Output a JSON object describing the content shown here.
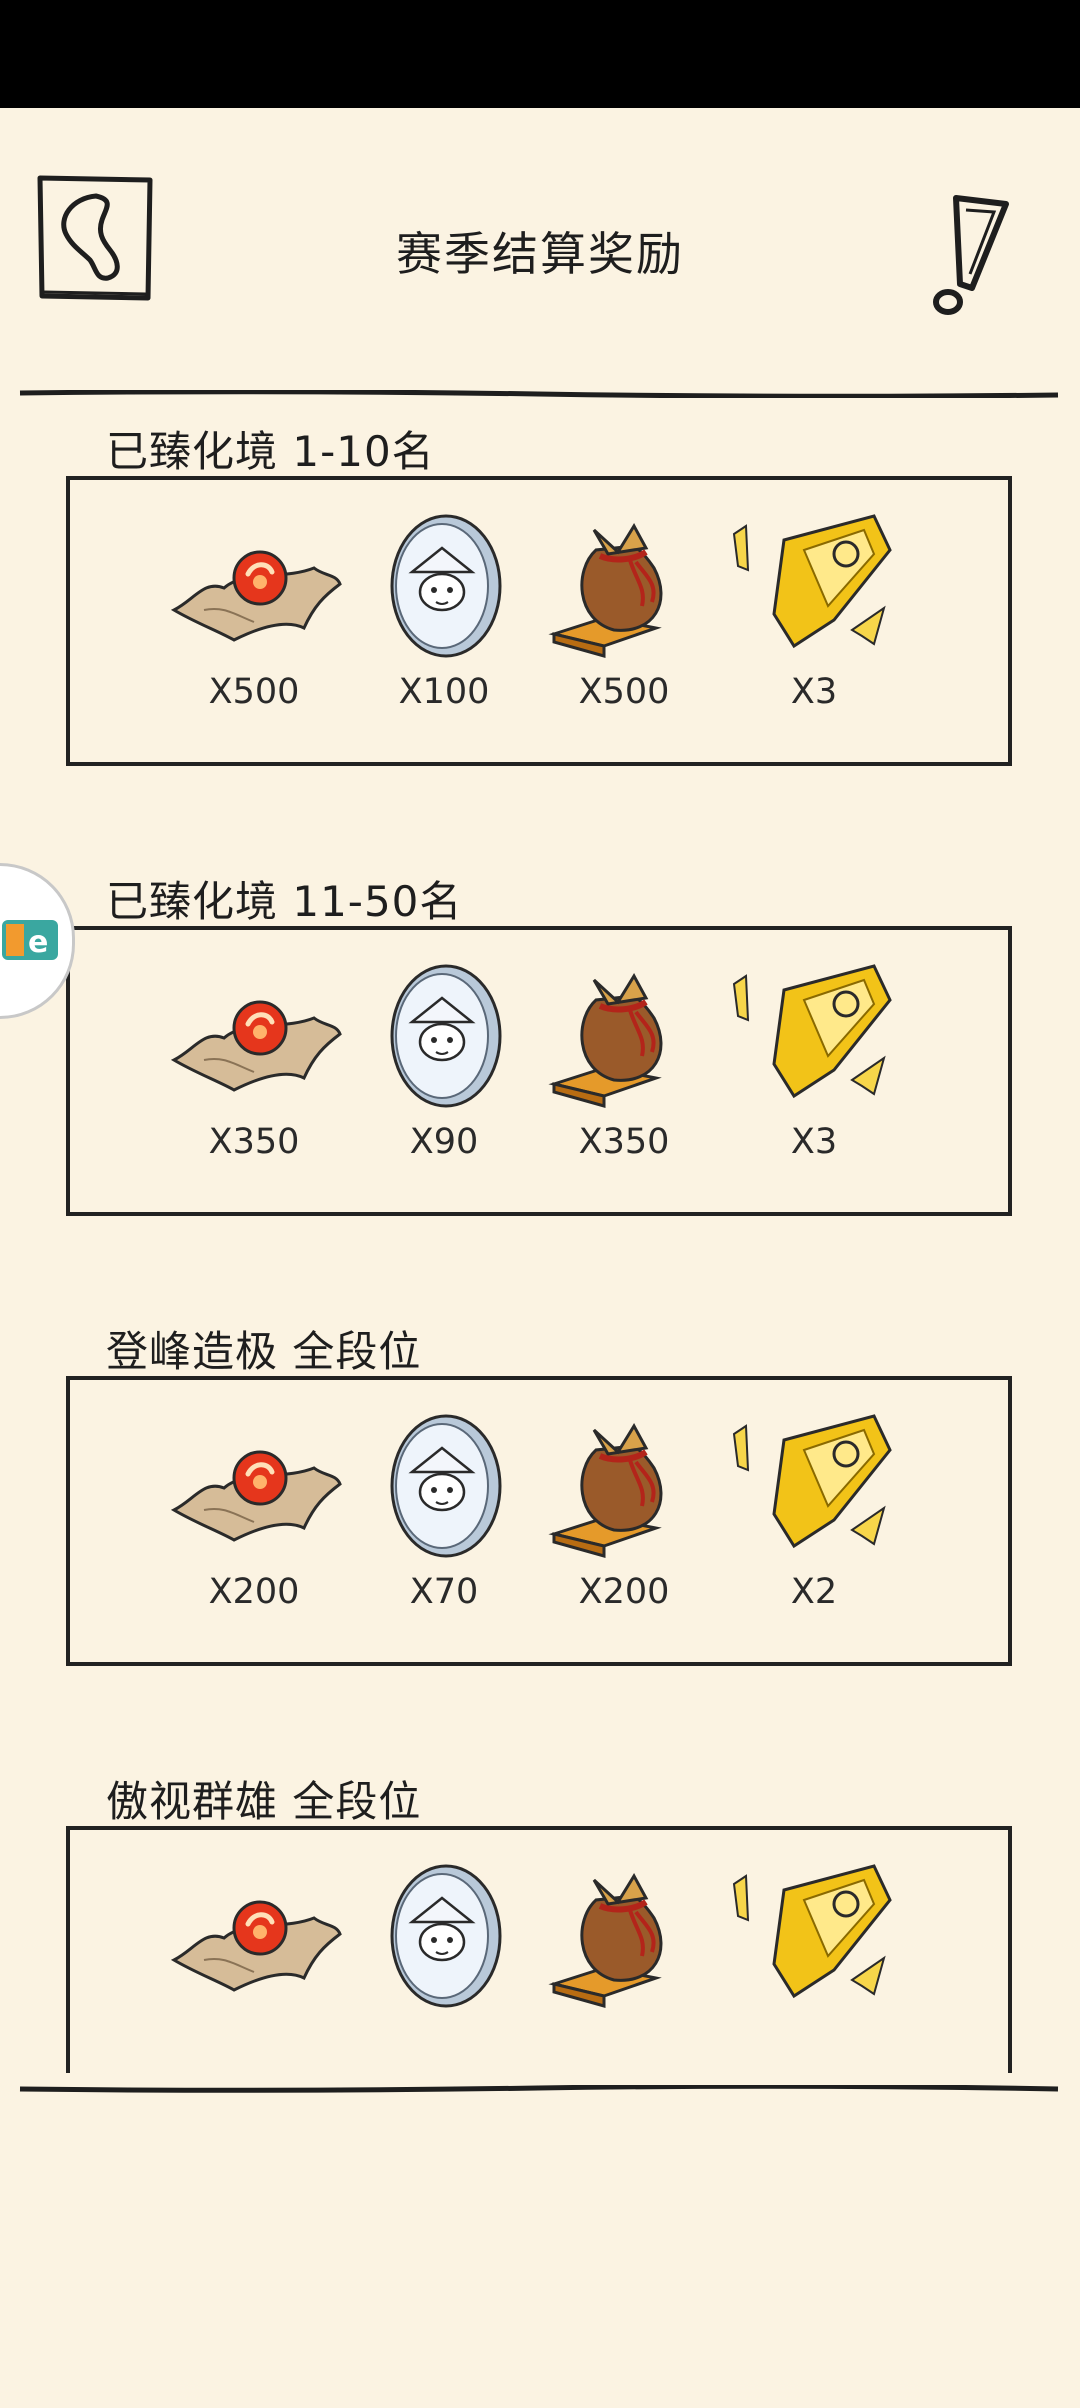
{
  "header": {
    "title": "赛季结算奖励"
  },
  "tiers": [
    {
      "title": "已臻化境 1-10名",
      "rewards": [
        {
          "icon": "pearl-on-cloth-icon",
          "count": "X500"
        },
        {
          "icon": "silver-coin-icon",
          "count": "X100"
        },
        {
          "icon": "money-pouch-icon",
          "count": "X500"
        },
        {
          "icon": "golden-shard-icon",
          "count": "X3"
        }
      ]
    },
    {
      "title": "已臻化境 11-50名",
      "rewards": [
        {
          "icon": "pearl-on-cloth-icon",
          "count": "X350"
        },
        {
          "icon": "silver-coin-icon",
          "count": "X90"
        },
        {
          "icon": "money-pouch-icon",
          "count": "X350"
        },
        {
          "icon": "golden-shard-icon",
          "count": "X3"
        }
      ]
    },
    {
      "title": "登峰造极 全段位",
      "rewards": [
        {
          "icon": "pearl-on-cloth-icon",
          "count": "X200"
        },
        {
          "icon": "silver-coin-icon",
          "count": "X70"
        },
        {
          "icon": "money-pouch-icon",
          "count": "X200"
        },
        {
          "icon": "golden-shard-icon",
          "count": "X2"
        }
      ]
    },
    {
      "title": "傲视群雄 全段位",
      "rewards": [
        {
          "icon": "pearl-on-cloth-icon",
          "count": ""
        },
        {
          "icon": "silver-coin-icon",
          "count": ""
        },
        {
          "icon": "money-pouch-icon",
          "count": ""
        },
        {
          "icon": "golden-shard-icon",
          "count": ""
        }
      ]
    }
  ],
  "colors": {
    "background": "#fbf3e2",
    "ink": "#1e1e1e",
    "pearl": "#e5361c",
    "gold": "#f2c318",
    "pouch": "#9a5a2a"
  }
}
